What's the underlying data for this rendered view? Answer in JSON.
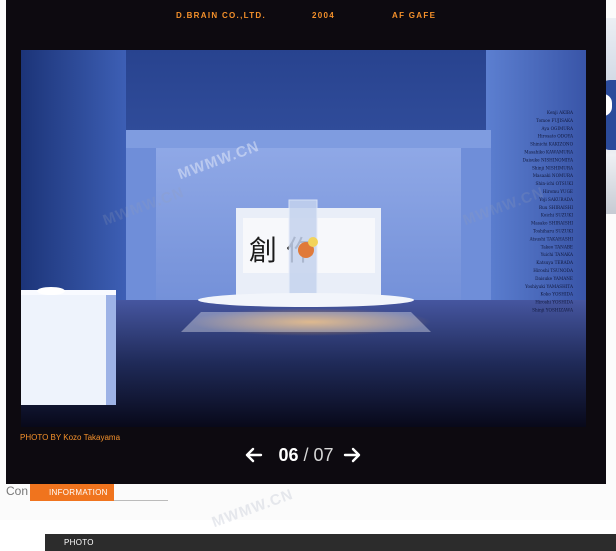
{
  "header": {
    "company": "D.BRAIN CO.,LTD.",
    "year": "2004",
    "project": "AF GAFE"
  },
  "photo": {
    "credit": "PHOTO BY Kozo Takayama",
    "wall_names": [
      "Kenji AKIBA",
      "Tomoe FUJISAKA",
      "Aya OGIMURA",
      "Hirosato ODOYA",
      "Shinichi KAKIZONO",
      "Masahiko KAWAMURA",
      "Daisuke NISHINOMIYA",
      "Shinji NISHIMURA",
      "Masaaki NOMURA",
      "Shin-ichi OTSUKI",
      "Hiromu YUGE",
      "Yoji SAKURADA",
      "Ruu SHIRAISHI",
      "Koichi SUZUKI",
      "Masako SHIRAISHI",
      "Toshiharu SUZUKI",
      "Atsushi TAKAHASHI",
      "Takeo TANABE",
      "Yuichi TANAKA",
      "Katsuya TERADA",
      "Hiroshi TSUNODA",
      "Daisuke YAMANE",
      "Yoshiyuki YAMASHITA",
      "Koko YOSHIDA",
      "Hiroshi YOSHIDA",
      "Shinji YOSHIZAWA"
    ],
    "watermarks": [
      "MWMW.CN",
      "MWMW.CN",
      "MWMW.CN",
      "MWMW.CN"
    ]
  },
  "nav": {
    "current": "06",
    "separator": "/",
    "total": "07"
  },
  "page_behind": {
    "text_fragment": "Con"
  },
  "menu": {
    "items": [
      "PHOTO",
      "INFORMATION"
    ]
  },
  "colors": {
    "accent": "#f5912b",
    "lightbox_bg": "#0d0a10",
    "menu_active": "#f0741e",
    "menu_bg": "#2c2c2c"
  },
  "icons": {
    "prev": "arrow-left-icon",
    "next": "arrow-right-icon"
  }
}
